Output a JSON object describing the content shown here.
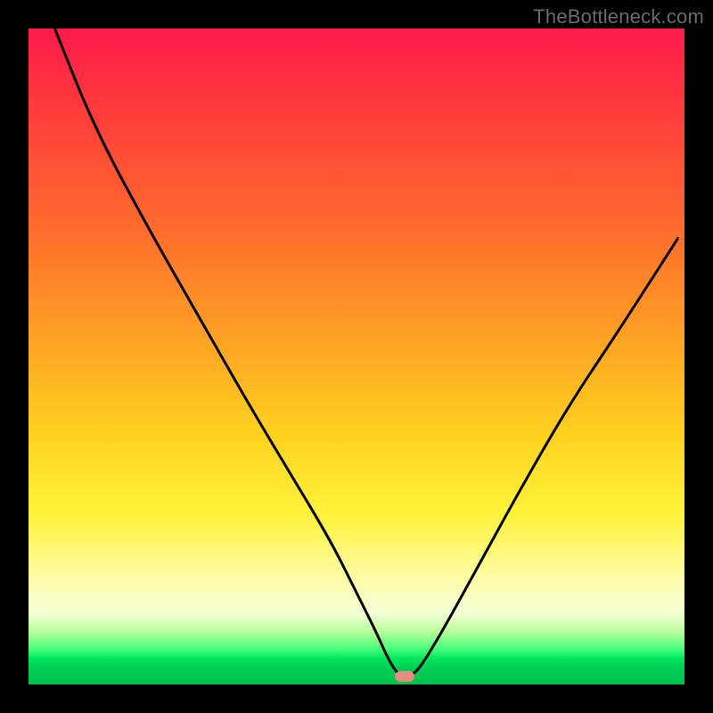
{
  "watermark": {
    "text": "TheBottleneck.com"
  },
  "chart_data": {
    "type": "line",
    "title": "",
    "xlabel": "",
    "ylabel": "",
    "xlim": [
      0,
      100
    ],
    "ylim": [
      0,
      100
    ],
    "series": [
      {
        "name": "bottleneck-curve",
        "x": [
          4,
          10,
          18,
          26,
          34,
          40,
          46,
          50,
          53,
          55,
          56.5,
          57.3,
          58.5,
          60,
          63,
          68,
          74,
          82,
          90,
          99
        ],
        "y": [
          100,
          85,
          70,
          56,
          42,
          32,
          22,
          14,
          8,
          3.5,
          1.4,
          1.2,
          1.4,
          3,
          8,
          17,
          28,
          42,
          54,
          68
        ]
      }
    ],
    "marker": {
      "x_percent": 57.3,
      "y_percent": 1.2,
      "color": "#e88b82"
    },
    "background_gradient": {
      "stops": [
        {
          "pos": 0,
          "color": "#ff1a4a"
        },
        {
          "pos": 0.48,
          "color": "#ffa423"
        },
        {
          "pos": 0.74,
          "color": "#fff23a"
        },
        {
          "pos": 0.96,
          "color": "#00e860"
        },
        {
          "pos": 1.0,
          "color": "#00c14e"
        }
      ]
    }
  }
}
